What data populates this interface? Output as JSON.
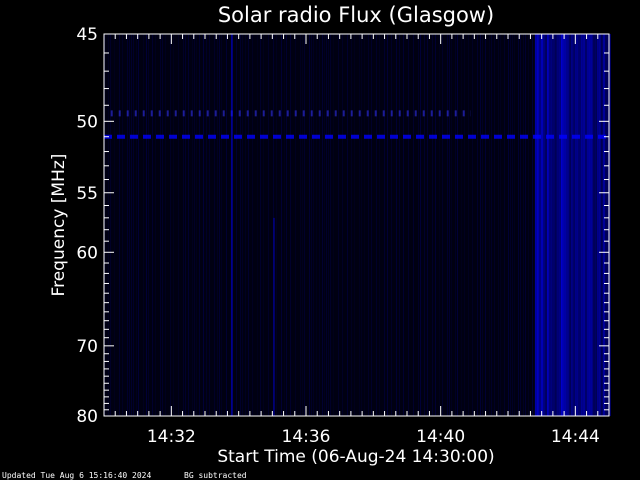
{
  "chart_data": {
    "type": "heatmap",
    "title": "Solar radio Flux (Glasgow)",
    "xlabel": "Start Time (06-Aug-24 14:30:00)",
    "ylabel": "Frequency [MHz]",
    "x_range_minutes": [
      0,
      15
    ],
    "x_ticks": [
      {
        "minute": 2,
        "label": "14:32"
      },
      {
        "minute": 6,
        "label": "14:36"
      },
      {
        "minute": 10,
        "label": "14:40"
      },
      {
        "minute": 14,
        "label": "14:44"
      }
    ],
    "ylim_mhz": [
      45,
      80
    ],
    "y_scale": "reciprocal",
    "y_ticks": [
      45,
      50,
      55,
      60,
      70,
      80
    ],
    "colormap": {
      "low": "#000000",
      "high": "#0000ff"
    },
    "grid": false,
    "features": [
      {
        "kind": "narrowband_line",
        "frequency_mhz": 51.0,
        "minute_start": 0.0,
        "minute_end": 15.0,
        "intensity": 0.8
      },
      {
        "kind": "narrowband_line_dotted",
        "frequency_mhz": 49.5,
        "minute_start": 0.2,
        "minute_end": 10.9,
        "intensity": 0.55
      },
      {
        "kind": "broadband_emission",
        "minute_start": 12.8,
        "minute_end": 15.0,
        "frequency_mhz": [
          45,
          80
        ],
        "intensity": 0.75
      },
      {
        "kind": "spike",
        "minute": 3.8,
        "frequency_mhz": [
          45,
          80
        ],
        "intensity": 0.45
      },
      {
        "kind": "spike",
        "minute": 5.05,
        "frequency_mhz": [
          57,
          80
        ],
        "intensity": 0.35
      }
    ]
  },
  "footer": {
    "updated": "Updated Tue Aug  6 15:16:40 2024",
    "note": "BG subtracted"
  }
}
